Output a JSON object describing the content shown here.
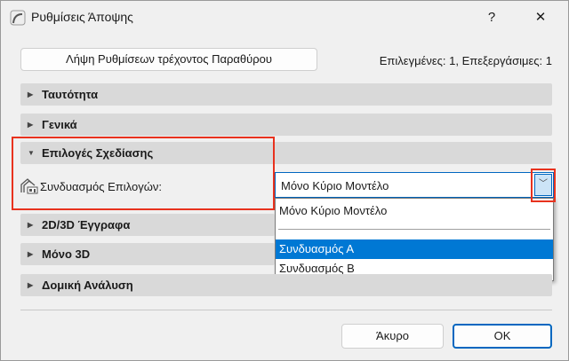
{
  "window": {
    "title": "Ρυθμίσεις Άποψης",
    "help": "?",
    "close": "✕"
  },
  "toolbar": {
    "get_settings_label": "Λήψη Ρυθμίσεων τρέχοντος Παραθύρου",
    "status": "Επιλεγμένες: 1, Επεξεργάσιμες: 1"
  },
  "sections": [
    {
      "label": "Ταυτότητα",
      "expanded": false
    },
    {
      "label": "Γενικά",
      "expanded": false
    },
    {
      "label": "Επιλογές Σχεδίασης",
      "expanded": true
    },
    {
      "label": "2D/3D Έγγραφα",
      "expanded": false
    },
    {
      "label": "Μόνο 3D",
      "expanded": false
    },
    {
      "label": "Δομική Ανάλυση",
      "expanded": false
    }
  ],
  "options_row": {
    "label": "Συνδυασμός Επιλογών:",
    "value": "Μόνο Κύριο Μοντέλο"
  },
  "dropdown_options": [
    "Μόνο Κύριο Μοντέλο",
    "Συνδυασμός Α",
    "Συνδυασμός Β"
  ],
  "highlighted_option": "Συνδυασμός Α",
  "footer": {
    "cancel": "Άκυρο",
    "ok": "OK"
  },
  "colors": {
    "accent": "#0078d4",
    "highlight_box": "#e8321e"
  }
}
